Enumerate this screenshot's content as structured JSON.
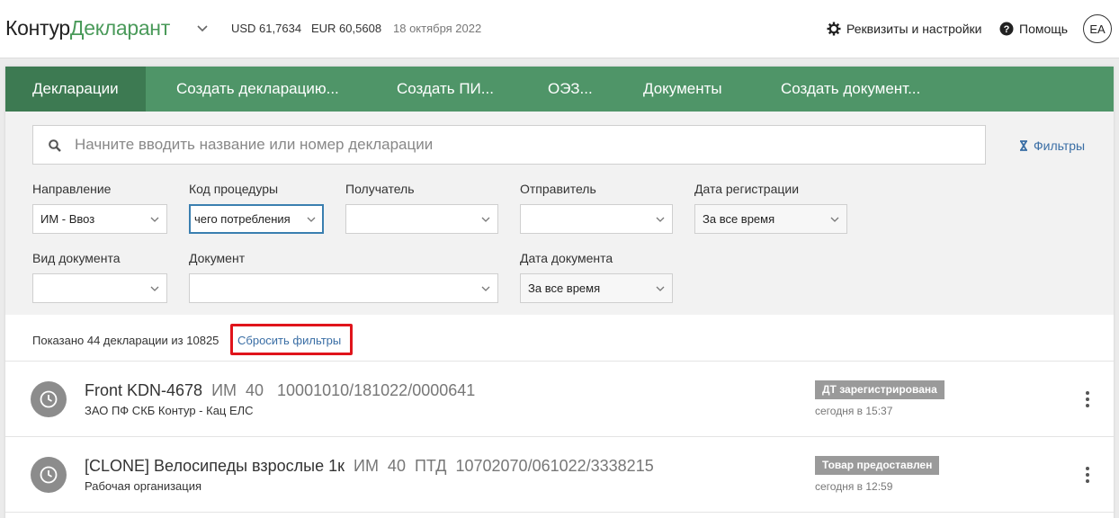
{
  "header": {
    "logo_part1": "Контур",
    "logo_part2": "Декларант",
    "usd": "USD 61,7634",
    "eur": "EUR 60,5608",
    "date": "18 октября 2022",
    "settings_label": "Реквизиты и настройки",
    "help_label": "Помощь",
    "avatar_initials": "ЕА"
  },
  "tabs": [
    {
      "label": "Декларации",
      "active": true
    },
    {
      "label": "Создать декларацию..."
    },
    {
      "label": "Создать ПИ..."
    },
    {
      "label": "ОЭЗ..."
    },
    {
      "label": "Документы"
    },
    {
      "label": "Создать документ..."
    }
  ],
  "search": {
    "placeholder": "Начните вводить название или номер декларации",
    "value": ""
  },
  "filters_link": "Фильтры",
  "filters": {
    "direction": {
      "label": "Направление",
      "value": "ИМ - Ввоз"
    },
    "procedure": {
      "label": "Код процедуры",
      "value": "чего потребления"
    },
    "recipient": {
      "label": "Получатель",
      "value": ""
    },
    "sender": {
      "label": "Отправитель",
      "value": ""
    },
    "reg_date": {
      "label": "Дата регистрации",
      "value": "За все время"
    },
    "doc_type": {
      "label": "Вид документа",
      "value": ""
    },
    "document": {
      "label": "Документ",
      "value": ""
    },
    "doc_date": {
      "label": "Дата документа",
      "value": "За все время"
    }
  },
  "summary": {
    "text": "Показано 44 декларации из 10825",
    "reset_label": "Сбросить фильтры"
  },
  "rows": [
    {
      "name": "Front KDN-4678",
      "meta": "ИМ  40   10001010/181022/0000641",
      "org": "ЗАО ПФ СКБ Контур - Кац ЕЛС",
      "status": "ДТ зарегистрирована",
      "time": "сегодня в 15:37"
    },
    {
      "name": "[CLONE] Велосипеды взрослые 1к",
      "meta": "ИМ  40  ПТД  10702070/061022/3338215",
      "org": "Рабочая организация",
      "status": "Товар предоставлен",
      "time": "сегодня в 12:59"
    }
  ],
  "colors": {
    "tab_bar": "#4f9568",
    "tab_active": "#3d7a52",
    "link": "#3a6ea5",
    "highlight": "#e0141b"
  }
}
